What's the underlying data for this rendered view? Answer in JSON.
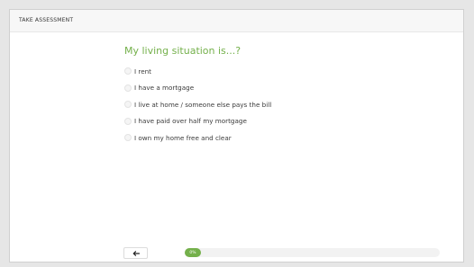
{
  "header": {
    "title": "TAKE ASSESSMENT"
  },
  "question": {
    "text": "My living situation is...?"
  },
  "options": [
    {
      "label": "I rent"
    },
    {
      "label": "I have a mortgage"
    },
    {
      "label": "I live at home / someone else pays the bill"
    },
    {
      "label": "I have paid over half my mortgage"
    },
    {
      "label": "I own my home free and clear"
    }
  ],
  "navigation": {
    "back_icon": "arrow-left-icon"
  },
  "progress": {
    "label": "0%",
    "value": 0
  },
  "colors": {
    "accent": "#74b04b"
  }
}
